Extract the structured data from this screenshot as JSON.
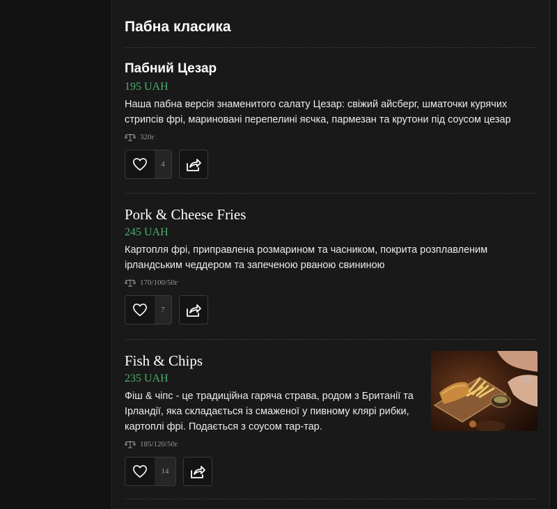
{
  "section": {
    "title": "Пабна класика"
  },
  "items": [
    {
      "title": "Пабний Цезар",
      "price": "195 UAH",
      "description": "Наша пабна версія знаменитого салату Цезар: свіжий айсберг, шматочки курячих стрипсів фрі, мариновані перепелині яєчка, пармезан та крутони під соусом цезар",
      "weight": "320г",
      "likes": "4"
    },
    {
      "title": "Pork & Cheese Fries",
      "price": "245 UAH",
      "description": "Картопля фрі, приправлена розмарином та часником, покрита розплавленим ірландським чеддером та запеченою рваною свининою",
      "weight": "170/100/50г",
      "likes": "7"
    },
    {
      "title": "Fish & Chips",
      "price": "235 UAH",
      "description": "Фіш & чіпс - це традиційна гаряча страва, родом з Британії та Ірландії, яка складається із смаженої у пивному клярі рибки, картоплі фрі. Подається з соусом тар-тар.",
      "weight": "185/120/50г",
      "likes": "14"
    }
  ],
  "icons": {
    "weight": "scale-icon",
    "like": "heart-icon",
    "share": "share-icon"
  },
  "colors": {
    "background": "#121212",
    "panel": "#191919",
    "price": "#4caf6e"
  }
}
